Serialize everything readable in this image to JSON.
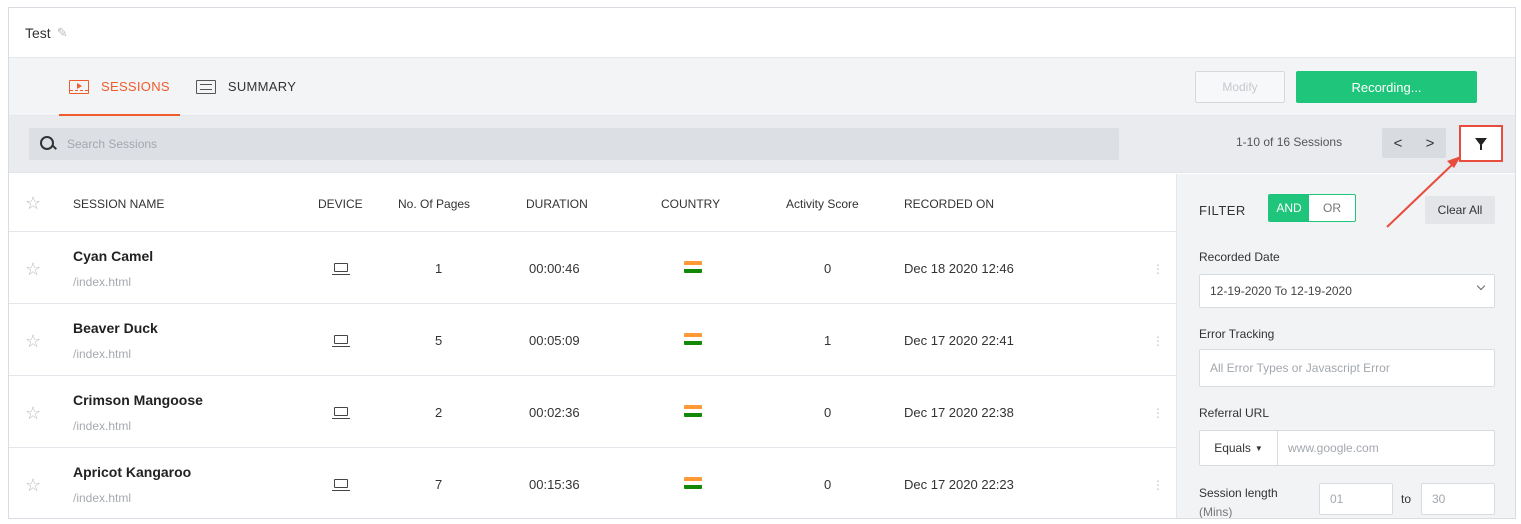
{
  "header": {
    "title": "Test",
    "edit_icon": "pencil-icon"
  },
  "tabs": [
    {
      "label": "SESSIONS",
      "icon": "film-icon",
      "active": true
    },
    {
      "label": "SUMMARY",
      "icon": "document-icon",
      "active": false
    }
  ],
  "toolbar": {
    "modify_label": "Modify",
    "recording_label": "Recording..."
  },
  "search": {
    "placeholder": "Search Sessions"
  },
  "pager": {
    "text": "1-10 of 16 Sessions",
    "prev": "<",
    "next": ">"
  },
  "table": {
    "columns": [
      "SESSION NAME",
      "DEVICE",
      "No. Of Pages",
      "DURATION",
      "COUNTRY",
      "Activity Score",
      "RECORDED ON"
    ],
    "rows": [
      {
        "name": "Cyan Camel",
        "path": "/index.html",
        "device": "laptop",
        "pages": "1",
        "duration": "00:00:46",
        "country": "India",
        "score": "0",
        "recorded": "Dec 18 2020 12:46"
      },
      {
        "name": "Beaver Duck",
        "path": "/index.html",
        "device": "laptop",
        "pages": "5",
        "duration": "00:05:09",
        "country": "India",
        "score": "1",
        "recorded": "Dec 17 2020 22:41"
      },
      {
        "name": "Crimson Mangoose",
        "path": "/index.html",
        "device": "laptop",
        "pages": "2",
        "duration": "00:02:36",
        "country": "India",
        "score": "0",
        "recorded": "Dec 17 2020 22:38"
      },
      {
        "name": "Apricot Kangaroo",
        "path": "/index.html",
        "device": "laptop",
        "pages": "7",
        "duration": "00:15:36",
        "country": "India",
        "score": "0",
        "recorded": "Dec 17 2020 22:23"
      }
    ]
  },
  "filter": {
    "title": "FILTER",
    "and_label": "AND",
    "or_label": "OR",
    "clear_label": "Clear All",
    "recorded_date_label": "Recorded Date",
    "recorded_date_value": "12-19-2020 To 12-19-2020",
    "error_tracking_label": "Error Tracking",
    "error_tracking_placeholder": "All Error Types or Javascript Error",
    "referral_label": "Referral URL",
    "referral_operator": "Equals",
    "referral_placeholder": "www.google.com",
    "session_length_label": "Session length",
    "session_length_unit": "(Mins)",
    "session_min_placeholder": "01",
    "session_to_label": "to",
    "session_max_placeholder": "30"
  },
  "colors": {
    "accent": "#f15a2b",
    "green": "#1ec57a",
    "highlight": "#e74c3c"
  }
}
